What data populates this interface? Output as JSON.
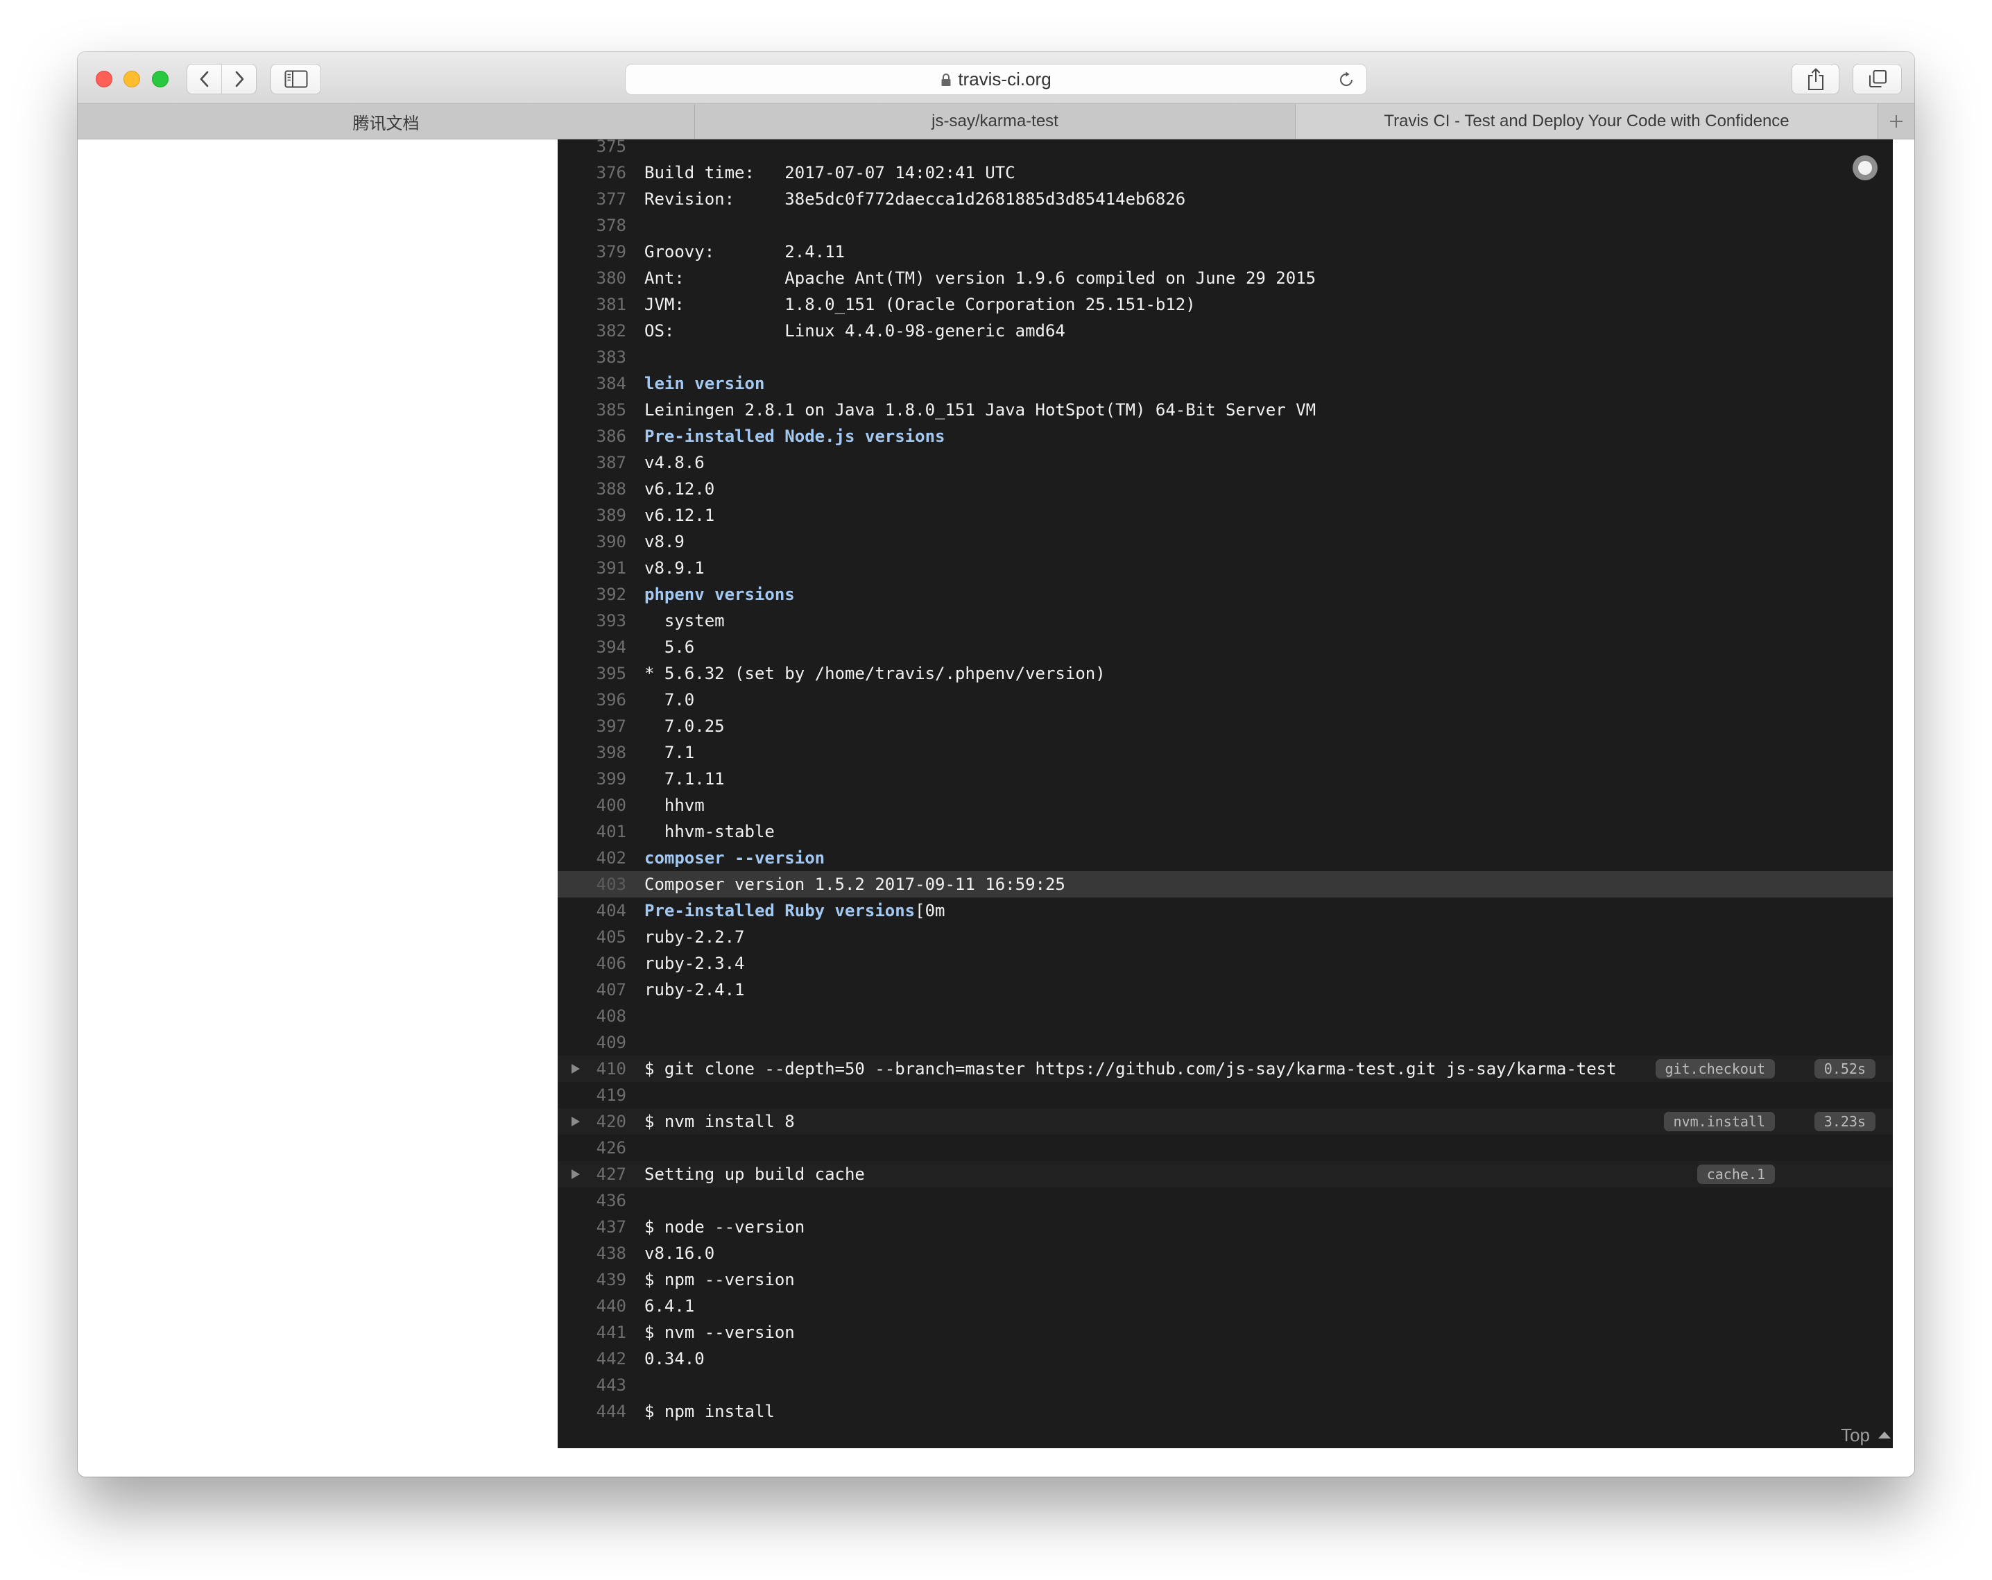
{
  "browser": {
    "url": "travis-ci.org",
    "tabs": [
      {
        "title": "腾讯文档",
        "active": false
      },
      {
        "title": "js-say/karma-test",
        "active": false
      },
      {
        "title": "Travis CI - Test and Deploy Your Code with Confidence",
        "active": true
      }
    ],
    "icons": {
      "close": "close-window-icon",
      "minimize": "minimize-window-icon",
      "zoom": "zoom-window-icon",
      "back": "chevron-left-icon",
      "forward": "chevron-right-icon",
      "sidebar": "sidebar-icon",
      "secure": "lock-icon",
      "reload": "reload-icon",
      "share": "share-icon",
      "tabs": "tabs-overview-icon",
      "new_tab": "plus-icon"
    }
  },
  "colors": {
    "log_background": "#1c1c1c",
    "log_text": "#f1f1f1",
    "log_heading": "#a3c8f2",
    "line_number": "#6e6e6e",
    "highlight_row": "#383838",
    "fold_row": "#212121",
    "badge_background": "#474747",
    "badge_text": "#bdbdbd"
  },
  "log": {
    "top_link": "Top",
    "lines": [
      {
        "num": "375",
        "text": ""
      },
      {
        "num": "376",
        "text": "Build time:   2017-07-07 14:02:41 UTC"
      },
      {
        "num": "377",
        "text": "Revision:     38e5dc0f772daecca1d2681885d3d85414eb6826"
      },
      {
        "num": "378",
        "text": ""
      },
      {
        "num": "379",
        "text": "Groovy:       2.4.11"
      },
      {
        "num": "380",
        "text": "Ant:          Apache Ant(TM) version 1.9.6 compiled on June 29 2015"
      },
      {
        "num": "381",
        "text": "JVM:          1.8.0_151 (Oracle Corporation 25.151-b12)"
      },
      {
        "num": "382",
        "text": "OS:           Linux 4.4.0-98-generic amd64"
      },
      {
        "num": "383",
        "text": ""
      },
      {
        "num": "384",
        "text": "lein version",
        "bold": true
      },
      {
        "num": "385",
        "text": "Leiningen 2.8.1 on Java 1.8.0_151 Java HotSpot(TM) 64-Bit Server VM"
      },
      {
        "num": "386",
        "text": "Pre-installed Node.js versions",
        "bold": true
      },
      {
        "num": "387",
        "text": "v4.8.6"
      },
      {
        "num": "388",
        "text": "v6.12.0"
      },
      {
        "num": "389",
        "text": "v6.12.1"
      },
      {
        "num": "390",
        "text": "v8.9"
      },
      {
        "num": "391",
        "text": "v8.9.1"
      },
      {
        "num": "392",
        "text": "phpenv versions",
        "bold": true
      },
      {
        "num": "393",
        "text": "  system"
      },
      {
        "num": "394",
        "text": "  5.6"
      },
      {
        "num": "395",
        "text": "* 5.6.32 (set by /home/travis/.phpenv/version)"
      },
      {
        "num": "396",
        "text": "  7.0"
      },
      {
        "num": "397",
        "text": "  7.0.25"
      },
      {
        "num": "398",
        "text": "  7.1"
      },
      {
        "num": "399",
        "text": "  7.1.11"
      },
      {
        "num": "400",
        "text": "  hhvm"
      },
      {
        "num": "401",
        "text": "  hhvm-stable"
      },
      {
        "num": "402",
        "text": "composer --version",
        "bold": true
      },
      {
        "num": "403",
        "text": "Composer version 1.5.2 2017-09-11 16:59:25",
        "highlight": true
      },
      {
        "num": "404",
        "text": "Pre-installed Ruby versions",
        "bold": true,
        "suffix": "[0m"
      },
      {
        "num": "405",
        "text": "ruby-2.2.7"
      },
      {
        "num": "406",
        "text": "ruby-2.3.4"
      },
      {
        "num": "407",
        "text": "ruby-2.4.1"
      },
      {
        "num": "408",
        "text": ""
      },
      {
        "num": "409",
        "text": ""
      },
      {
        "num": "410",
        "text": "$ git clone --depth=50 --branch=master https://github.com/js-say/karma-test.git js-say/karma-test",
        "fold": true,
        "stage": "git.checkout",
        "duration": "0.52s"
      },
      {
        "num": "419",
        "text": ""
      },
      {
        "num": "420",
        "text": "$ nvm install 8",
        "fold": true,
        "stage": "nvm.install",
        "duration": "3.23s"
      },
      {
        "num": "426",
        "text": ""
      },
      {
        "num": "427",
        "text": "Setting up build cache",
        "fold": true,
        "stage": "cache.1"
      },
      {
        "num": "436",
        "text": ""
      },
      {
        "num": "437",
        "text": "$ node --version"
      },
      {
        "num": "438",
        "text": "v8.16.0"
      },
      {
        "num": "439",
        "text": "$ npm --version"
      },
      {
        "num": "440",
        "text": "6.4.1"
      },
      {
        "num": "441",
        "text": "$ nvm --version"
      },
      {
        "num": "442",
        "text": "0.34.0"
      },
      {
        "num": "443",
        "text": ""
      },
      {
        "num": "444",
        "text": "$ npm install"
      }
    ]
  }
}
